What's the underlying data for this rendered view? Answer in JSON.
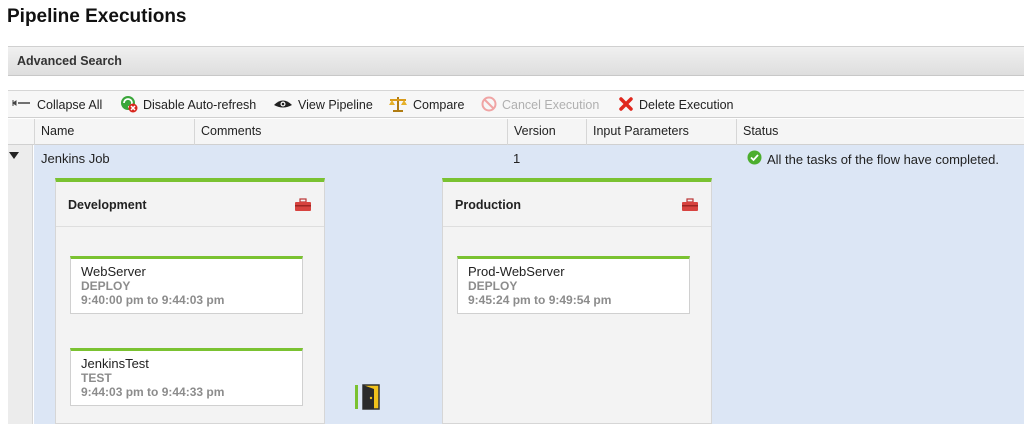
{
  "page": {
    "title": "Pipeline Executions"
  },
  "advanced_search": {
    "label": "Advanced Search"
  },
  "toolbar": {
    "collapse_all": "Collapse All",
    "disable_auto_refresh": "Disable Auto-refresh",
    "view_pipeline": "View Pipeline",
    "compare": "Compare",
    "cancel_execution": "Cancel Execution",
    "delete_execution": "Delete Execution"
  },
  "columns": {
    "name": "Name",
    "comments": "Comments",
    "version": "Version",
    "input_parameters": "Input Parameters",
    "status": "Status"
  },
  "execution": {
    "name": "Jenkins Job",
    "version": "1",
    "status": "All the tasks of the flow have completed.",
    "status_color": "#4cae2e"
  },
  "stages": [
    {
      "name": "Development",
      "tasks": [
        {
          "name": "WebServer",
          "type": "DEPLOY",
          "time": "9:40:00 pm to 9:44:03 pm"
        },
        {
          "name": "JenkinsTest",
          "type": "TEST",
          "time": "9:44:03 pm to 9:44:33 pm"
        }
      ]
    },
    {
      "name": "Production",
      "tasks": [
        {
          "name": "Prod-WebServer",
          "type": "DEPLOY",
          "time": "9:45:24 pm to 9:49:54 pm"
        }
      ]
    }
  ],
  "colors": {
    "accent": "#7ac231",
    "row_bg": "#dce6f5",
    "delete": "#e0281e"
  }
}
